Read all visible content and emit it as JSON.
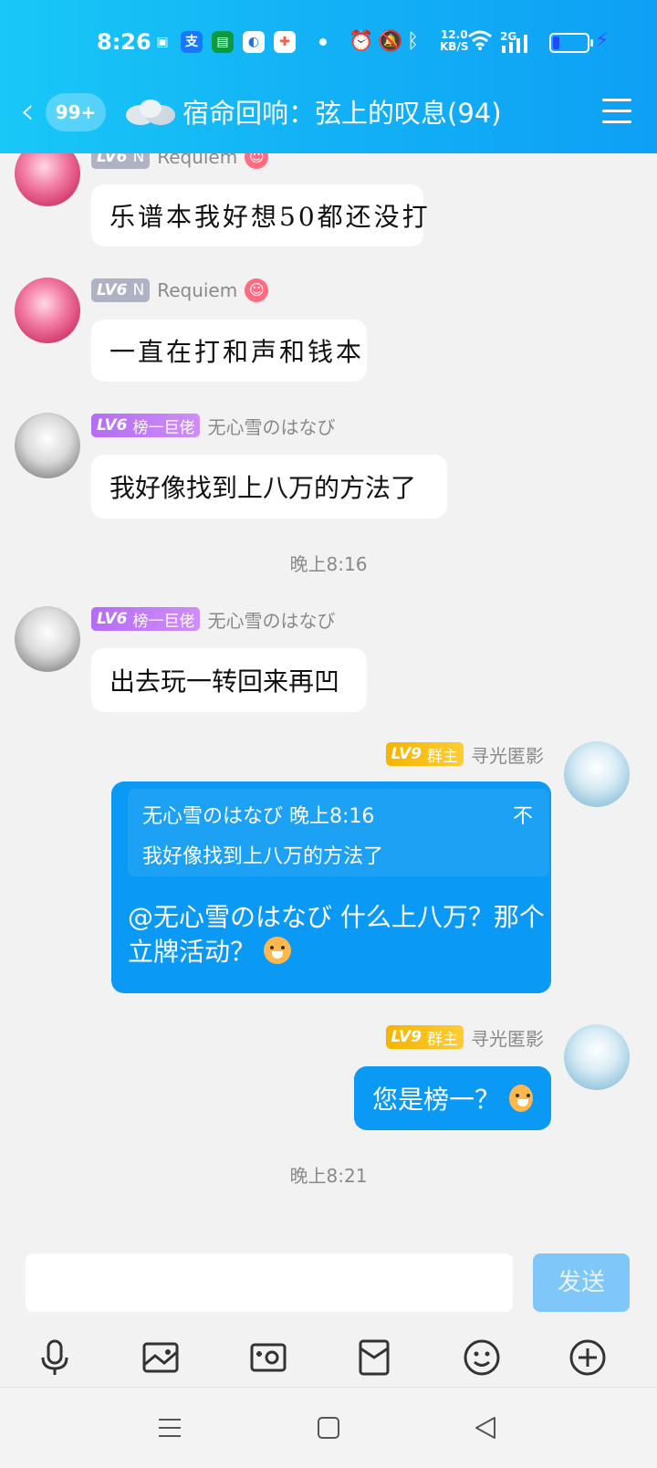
{
  "status_bar": {
    "time": "8:26",
    "net_speed_value": "12.0",
    "net_speed_unit": "KB/S",
    "signal": "2G",
    "battery_percent": 20
  },
  "header": {
    "back_badge": "99+",
    "title": "宿命回响：弦上的叹息(94)"
  },
  "messages": [
    {
      "level": "LV6",
      "rank": "N",
      "name": "Requiem",
      "text": "乐谱本我好想50都还没打"
    },
    {
      "level": "LV6",
      "rank": "N",
      "name": "Requiem",
      "text": "一直在打和声和钱本"
    },
    {
      "level": "LV6",
      "rank": "榜一巨佬",
      "name": "无心雪のはなび",
      "text": "我好像找到上八万的方法了"
    },
    {
      "timestamp": "晚上8:16"
    },
    {
      "level": "LV6",
      "rank": "榜一巨佬",
      "name": "无心雪のはなび",
      "text": "出去玩一转回来再凹"
    },
    {
      "level": "LV9",
      "rank": "群主",
      "name": "寻光匿影",
      "quote_header": "无心雪のはなび 晚上8:16",
      "quote_close": "不",
      "quote_text": "我好像找到上八万的方法了",
      "reply_text": "@无心雪のはなび 什么上八万？那个立牌活动？"
    },
    {
      "level": "LV9",
      "rank": "群主",
      "name": "寻光匿影",
      "text": "您是榜一？"
    },
    {
      "timestamp": "晚上8:21"
    }
  ],
  "input": {
    "send_label": "发送"
  },
  "colors": {
    "header_bg": "#13b3f6",
    "own_bubble": "#0a99f5",
    "lv_gray": "#aeb2c2",
    "lv_purple": "#b46cf5",
    "lv_gold": "#f5b400"
  }
}
